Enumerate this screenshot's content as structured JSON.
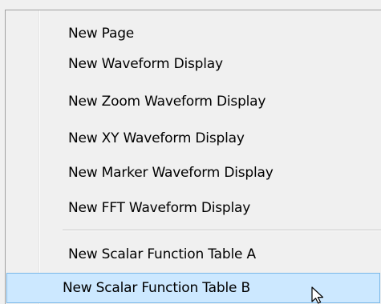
{
  "context_menu": {
    "items": [
      {
        "label": "New Page"
      },
      {
        "label": "New Waveform Display"
      },
      {
        "label": "New Zoom Waveform Display"
      },
      {
        "label": "New XY Waveform Display"
      },
      {
        "label": "New Marker Waveform Display"
      },
      {
        "label": "New FFT Waveform Display"
      },
      {
        "label": "New Scalar Function Table A"
      },
      {
        "label": "New Scalar Function Table B",
        "highlighted": true
      }
    ]
  },
  "colors": {
    "menu_background": "#f0f0f0",
    "highlight_background": "#cce8ff",
    "highlight_border": "#7ab8e8",
    "border": "#a0a0a0"
  },
  "icons": {
    "cursor": "mouse-pointer-icon"
  }
}
